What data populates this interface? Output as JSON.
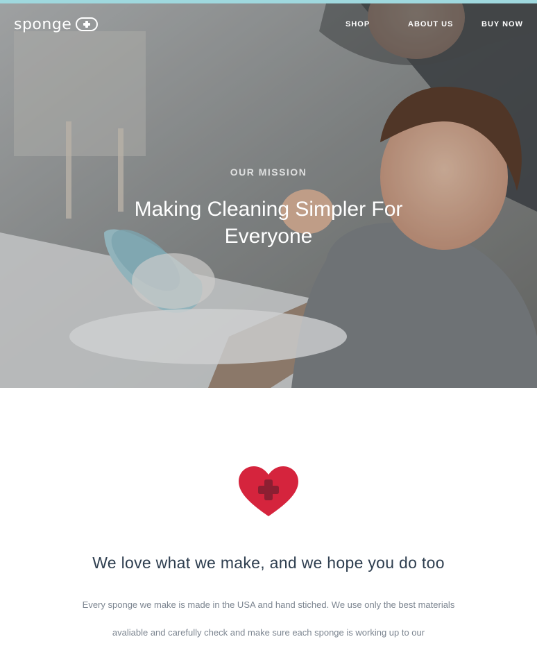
{
  "brand": {
    "name": "sponge",
    "logo_icon": "plus-pill-icon"
  },
  "nav": {
    "items": [
      {
        "label": "SHOP"
      },
      {
        "label": "ABOUT US"
      },
      {
        "label": "BUY NOW"
      }
    ]
  },
  "hero": {
    "eyebrow": "OUR MISSION",
    "title": "Making Cleaning Simpler For Everyone",
    "image": "photo-adult-and-child-washing-dishes"
  },
  "section": {
    "icon": "heart-plus-icon",
    "title": "We love what we make, and we hope you do too",
    "body": "Every sponge we make is made in the USA and hand stiched. We use only the best materials avaliable and carefully check and make sure each sponge is working up to our"
  },
  "colors": {
    "accent_strip": "#9fd8de",
    "heart": "#d5243d",
    "heart_plus": "#8c1f32",
    "heading": "#2e3e4f",
    "body_text": "#7c8590"
  }
}
